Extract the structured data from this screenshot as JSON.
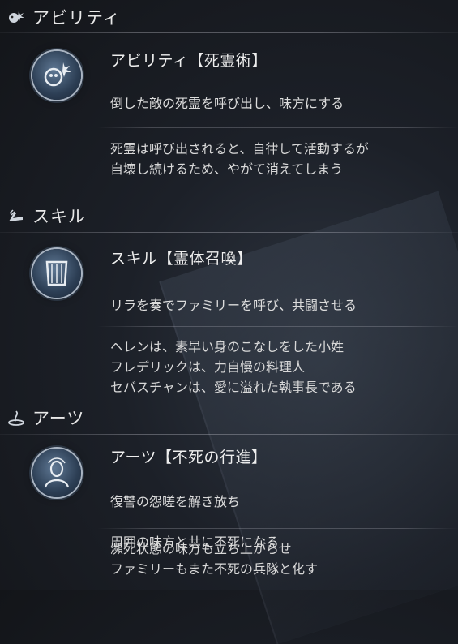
{
  "sections": [
    {
      "header": "アビリティ",
      "icon": "ability-icon",
      "title": "アビリティ【死霊術】",
      "description": [
        "倒した敵の死霊を呼び出し、味方にする"
      ],
      "flavor": [
        "死霊は呼び出されると、自律して活動するが",
        "自壊し続けるため、やがて消えてしまう"
      ],
      "emblem": "necromancy-emblem-icon"
    },
    {
      "header": "スキル",
      "icon": "skill-icon",
      "title": "スキル【霊体召喚】",
      "description": [
        "リラを奏でファミリーを呼び、共闘させる"
      ],
      "flavor": [
        "ヘレンは、素早い身のこなしをした小姓",
        "フレデリックは、力自慢の料理人",
        "セバスチャンは、愛に溢れた執事長である"
      ],
      "emblem": "lyre-emblem-icon"
    },
    {
      "header": "アーツ",
      "icon": "arts-icon",
      "title": "アーツ【不死の行進】",
      "description": [
        "復讐の怨嗟を解き放ち",
        "周囲の味方と共に不死になる"
      ],
      "flavor": [
        "瀕死状態の味方も立ち上がらせ",
        "ファミリーもまた不死の兵隊と化す"
      ],
      "emblem": "undead-march-emblem-icon"
    }
  ],
  "colors": {
    "text": "#e4e4e4",
    "emblem": "#2c3e54",
    "ring": "#a9b4c2"
  }
}
